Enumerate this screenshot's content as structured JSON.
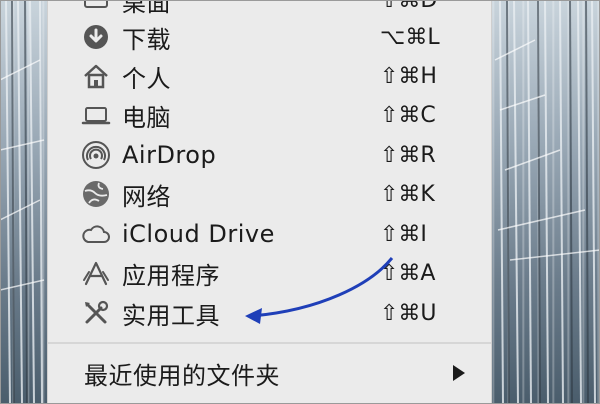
{
  "menu": {
    "top_partial": {
      "label": "桌面",
      "shortcut": "⇧⌘D",
      "icon": "desktop-icon"
    },
    "items": [
      {
        "label": "下载",
        "shortcut": "⌥⌘L",
        "icon": "download-icon"
      },
      {
        "label": "个人",
        "shortcut": "⇧⌘H",
        "icon": "home-icon"
      },
      {
        "label": "电脑",
        "shortcut": "⇧⌘C",
        "icon": "laptop-icon"
      },
      {
        "label": "AirDrop",
        "shortcut": "⇧⌘R",
        "icon": "airdrop-icon"
      },
      {
        "label": "网络",
        "shortcut": "⇧⌘K",
        "icon": "network-globe-icon"
      },
      {
        "label": "iCloud Drive",
        "shortcut": "⇧⌘I",
        "icon": "cloud-icon"
      },
      {
        "label": "应用程序",
        "shortcut": "⇧⌘A",
        "icon": "applications-icon"
      },
      {
        "label": "实用工具",
        "shortcut": "⇧⌘U",
        "icon": "utilities-tools-icon"
      }
    ],
    "recent_folders": {
      "label": "最近使用的文件夹",
      "icon": "submenu-arrow-icon"
    }
  },
  "annotation": {
    "color": "#1f3fb8",
    "points_to": "实用工具"
  }
}
